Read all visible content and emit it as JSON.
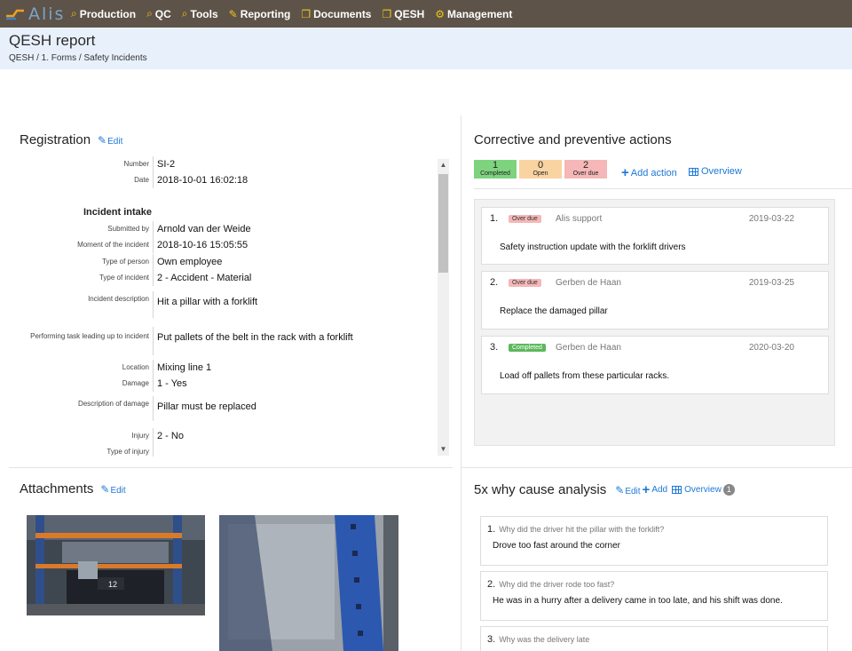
{
  "nav": {
    "logo_text": "Alis",
    "items": [
      {
        "icon": "search-icon",
        "label": "Production"
      },
      {
        "icon": "search-icon",
        "label": "QC"
      },
      {
        "icon": "search-icon",
        "label": "Tools"
      },
      {
        "icon": "report-icon",
        "label": "Reporting"
      },
      {
        "icon": "document-icon",
        "label": "Documents"
      },
      {
        "icon": "document-icon",
        "label": "QESH"
      },
      {
        "icon": "gear-icon",
        "label": "Management"
      }
    ]
  },
  "page": {
    "title": "QESH report",
    "breadcrumb": "QESH / 1. Forms / Safety Incidents"
  },
  "registration": {
    "title": "Registration",
    "edit_label": "Edit",
    "heading": "Incident intake",
    "fields": [
      {
        "label": "Number",
        "value": "SI-2"
      },
      {
        "label": "Date",
        "value": "2018-10-01 16:02:18"
      },
      {
        "label": "Submitted by",
        "value": "Arnold van der Weide"
      },
      {
        "label": "Moment of the incident",
        "value": "2018-10-16 15:05:55"
      },
      {
        "label": "Type of person",
        "value": "Own employee"
      },
      {
        "label": "Type of incident",
        "value": "2 - Accident - Material"
      },
      {
        "label": "Incident description",
        "value": "Hit a pillar with a forklift"
      },
      {
        "label": "Performing task leading up to incident",
        "value": "Put pallets of the belt in the rack with a forklift"
      },
      {
        "label": "Location",
        "value": "Mixing line 1"
      },
      {
        "label": "Damage",
        "value": "1 - Yes"
      },
      {
        "label": "Description of damage",
        "value": "Pillar must be replaced"
      },
      {
        "label": "Injury",
        "value": "2 - No"
      },
      {
        "label": "Type of injury",
        "value": ""
      }
    ]
  },
  "actions": {
    "title": "Corrective and preventive actions",
    "badges": [
      {
        "count": "1",
        "label": "Completed",
        "color": "#7ed37e"
      },
      {
        "count": "0",
        "label": "Open",
        "color": "#f9d4a2"
      },
      {
        "count": "2",
        "label": "Over due",
        "color": "#f5b7b7"
      }
    ],
    "add_label": "Add action",
    "overview_label": "Overview",
    "items": [
      {
        "num": "1.",
        "status": "Over due",
        "who": "Alis support",
        "date": "2019-03-22",
        "desc": "Safety instruction update with the forklift drivers"
      },
      {
        "num": "2.",
        "status": "Over due",
        "who": "Gerben de Haan",
        "date": "2019-03-25",
        "desc": "Replace the damaged pillar"
      },
      {
        "num": "3.",
        "status": "Completed",
        "who": "Gerben de Haan",
        "date": "2020-03-20",
        "desc": "Load off pallets from these particular racks."
      }
    ]
  },
  "attachments": {
    "title": "Attachments",
    "edit_label": "Edit",
    "photo_tag": "12"
  },
  "why": {
    "title": "5x why cause analysis",
    "edit_label": "Edit",
    "add_label": "Add",
    "overview_label": "Overview",
    "count": "1",
    "items": [
      {
        "num": "1.",
        "q": "Why did the driver hit the pillar with the forklift?",
        "a": "Drove too fast around the corner"
      },
      {
        "num": "2.",
        "q": "Why did the driver rode too fast?",
        "a": "He was in a hurry after a delivery came in too late, and his shift was done."
      },
      {
        "num": "3.",
        "q": "Why was the delivery late",
        "a": ""
      }
    ]
  }
}
